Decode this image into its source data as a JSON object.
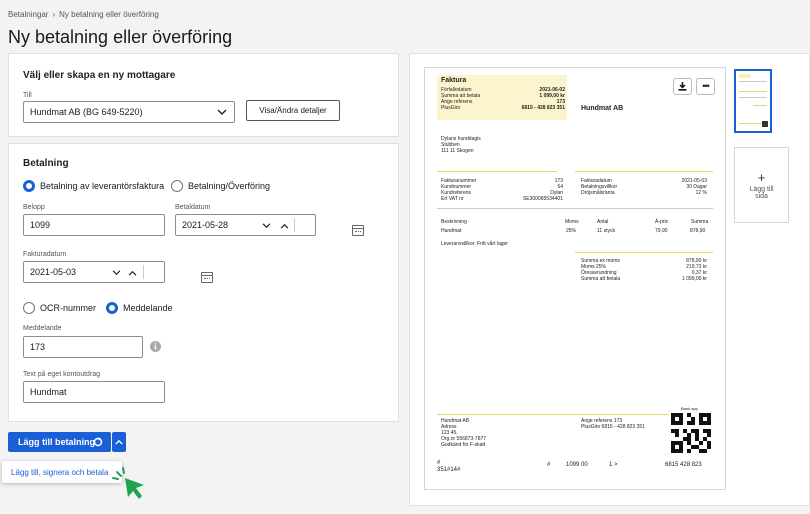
{
  "breadcrumb": {
    "root": "Betalningar",
    "sep": "›",
    "current": "Ny betalning eller överföring"
  },
  "page_title": "Ny betalning eller överföring",
  "recipient": {
    "heading": "Välj eller skapa en ny mottagare",
    "to_label": "Till",
    "to_value": "Hundmat AB (BG 649-5220)",
    "details_button": "Visa/Ändra detaljer"
  },
  "payment": {
    "heading": "Betalning",
    "radio_invoice": "Betalning av leverantörsfaktura",
    "radio_transfer": "Betalning/Överföring",
    "amount_label": "Belopp",
    "amount_value": "1099",
    "paydate_label": "Betaldatum",
    "paydate_value": "2021-05-28",
    "invoicedate_label": "Fakturadatum",
    "invoicedate_value": "2021-05-03",
    "radio_ocr": "OCR-nummer",
    "radio_message": "Meddelande",
    "message_label": "Meddelande",
    "message_value": "173",
    "statement_label": "Text på eget kontoutdrag",
    "statement_value": "Hundmat"
  },
  "actions": {
    "add_payment": "Lägg till betalning",
    "menu_item": "Lägg till, signera och betala"
  },
  "preview": {
    "add_page_plus": "+",
    "add_page_label_1": "Lägg till",
    "add_page_label_2": "sida"
  },
  "invoice": {
    "title": "Faktura",
    "head_labels": [
      "Förfallodatum",
      "Summa att betala",
      "Ange referens",
      "PlusGiro"
    ],
    "head_values": [
      "2021-06-02",
      "1 099,00 kr",
      "173",
      "6815 - 428 823 351"
    ],
    "company": "Hundmat AB",
    "customer": [
      "Dylans hunddagis",
      "Stubben",
      "111 11 Skogen"
    ],
    "info_left_labels": [
      "Fakturanummer",
      "Kundnummer",
      "Kundreferens",
      "Ert VAT nr"
    ],
    "info_left_values": [
      "173",
      "54",
      "Dylan",
      "SE300065534401"
    ],
    "info_right_labels": [
      "Fakturadatum",
      "Betalningsvillkor",
      "Dröjsmålsränta"
    ],
    "info_right_values": [
      "2021-05-03",
      "30 Dagar",
      "12 %"
    ],
    "col_headers": [
      "Beskrivning",
      "Moms",
      "Antal",
      "À-pris",
      "Summa"
    ],
    "row": [
      "Hundmat",
      "25%",
      "11 styck",
      "79,90",
      "878,90"
    ],
    "terms": "Leveransvillkor: Fritt vårt lager",
    "sum_labels": [
      "Summa ex moms",
      "Moms 25%",
      "Öresavrundning",
      "Summa att betala"
    ],
    "sum_values": [
      "878,90 kr",
      "219,73 kr",
      "0,37 kr",
      "1 099,00 kr"
    ],
    "bank_app": "Bank app",
    "footer_left": [
      "Hundmat AB",
      "Adress",
      "123 45,",
      "Org.nr 556873-7877",
      "Godkänd för F-skatt"
    ],
    "footer_mid": [
      "Ange referens  173",
      "PlusGiro    6815 - 428 823 351"
    ],
    "ocr_hash1": "#",
    "ocr_hash2": "#",
    "ocr_amount": "1099  00",
    "ocr_check": "1  >",
    "ocr_account": "6815  428  823",
    "ocr_ref": "351#14#"
  }
}
